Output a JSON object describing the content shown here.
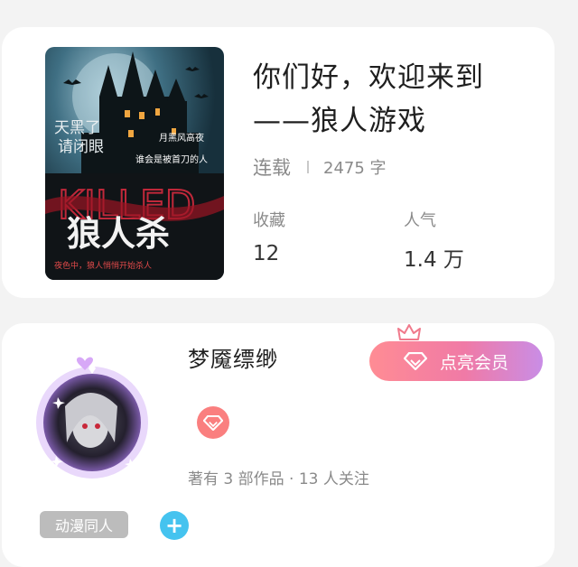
{
  "book": {
    "title_line1": "你们好，欢迎来到",
    "title_line2": "——狼人游戏",
    "status": "连载",
    "word_count": "2475 字",
    "favorites_label": "收藏",
    "favorites_value": "12",
    "popularity_label": "人气",
    "popularity_value": "1.4 万",
    "cover": {
      "text_top_left_1": "天黑了",
      "text_top_left_2": "请闭眼",
      "text_top_right": "月黑风高夜",
      "text_middle": "谁会是被首刀的人",
      "text_english": "KILLED",
      "text_main": "狼人杀",
      "text_bottom": "夜色中，狼人悄悄开始杀人"
    }
  },
  "author": {
    "name": "梦魇缥缈",
    "vip_button_label": "点亮会员",
    "stats": "著有 3 部作品 · 13 人关注",
    "tag": "动漫同人",
    "add_icon": "+"
  },
  "colors": {
    "background": "#f3f3f3",
    "vip_gradient_start": "#ff8c94",
    "vip_gradient_end": "#c98de6",
    "vip_badge": "#fa7f7f",
    "tag_bg": "#bcbcbc",
    "add_button": "#45c3ef"
  },
  "icons": {
    "vip": "diamond-icon",
    "crown": "crown-icon",
    "add": "plus-icon"
  }
}
